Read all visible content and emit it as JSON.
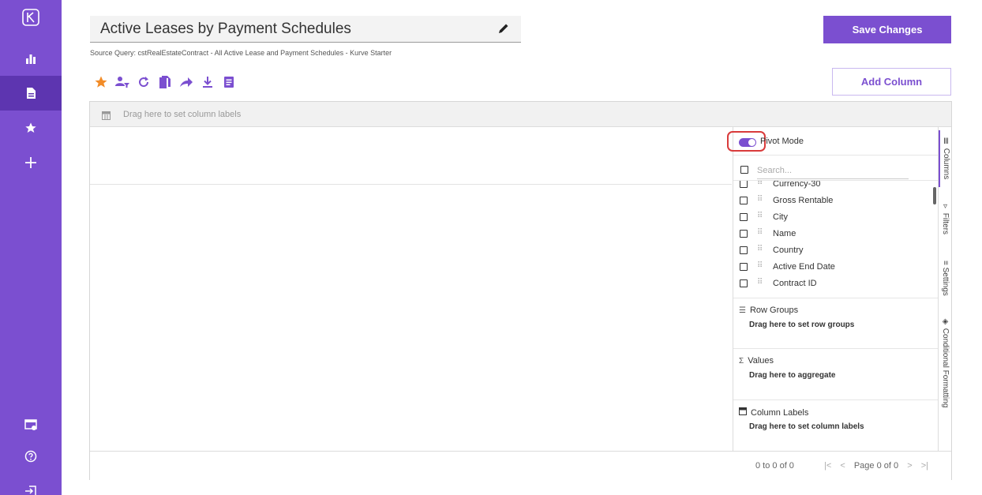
{
  "report": {
    "title": "Active Leases by Payment Schedules",
    "source_query": "Source Query: cstRealEstateContract - All Active Lease and Payment Schedules - Kurve Starter"
  },
  "buttons": {
    "save": "Save Changes",
    "add_column": "Add Column"
  },
  "toolbar": {
    "icons": [
      "star-icon",
      "user-filter-icon",
      "refresh-icon",
      "copy-icon",
      "share-icon",
      "download-icon",
      "document-icon"
    ],
    "star_color": "#f28c28",
    "icon_color": "#7b4fd0"
  },
  "sidebar": {
    "items": [
      "logo-icon",
      "dashboard-icon",
      "reports-icon",
      "favorites-icon",
      "add-icon",
      "admin-icon",
      "help-icon",
      "logout-icon"
    ]
  },
  "grid": {
    "drag_column_labels": "Drag here to set column labels",
    "pager": {
      "rows": "0 to 0 of 0",
      "page": "Page 0 of 0"
    }
  },
  "panel": {
    "pivot_mode": {
      "label": "Pivot Mode",
      "enabled": true
    },
    "search_placeholder": "Search...",
    "columns": [
      "Currency-30",
      "Gross Rentable",
      "City",
      "Name",
      "Country",
      "Active End Date",
      "Contract ID"
    ],
    "row_groups": {
      "title": "Row Groups",
      "drop": "Drag here to set row groups"
    },
    "values": {
      "title": "Values",
      "drop": "Drag here to aggregate"
    },
    "column_labels": {
      "title": "Column Labels",
      "drop": "Drag here to set column labels"
    }
  },
  "side_tabs": [
    "Columns",
    "Filters",
    "Settings",
    "Conditional Formatting"
  ],
  "colors": {
    "brand": "#7b4fd0",
    "highlight": "#d93b3b"
  }
}
